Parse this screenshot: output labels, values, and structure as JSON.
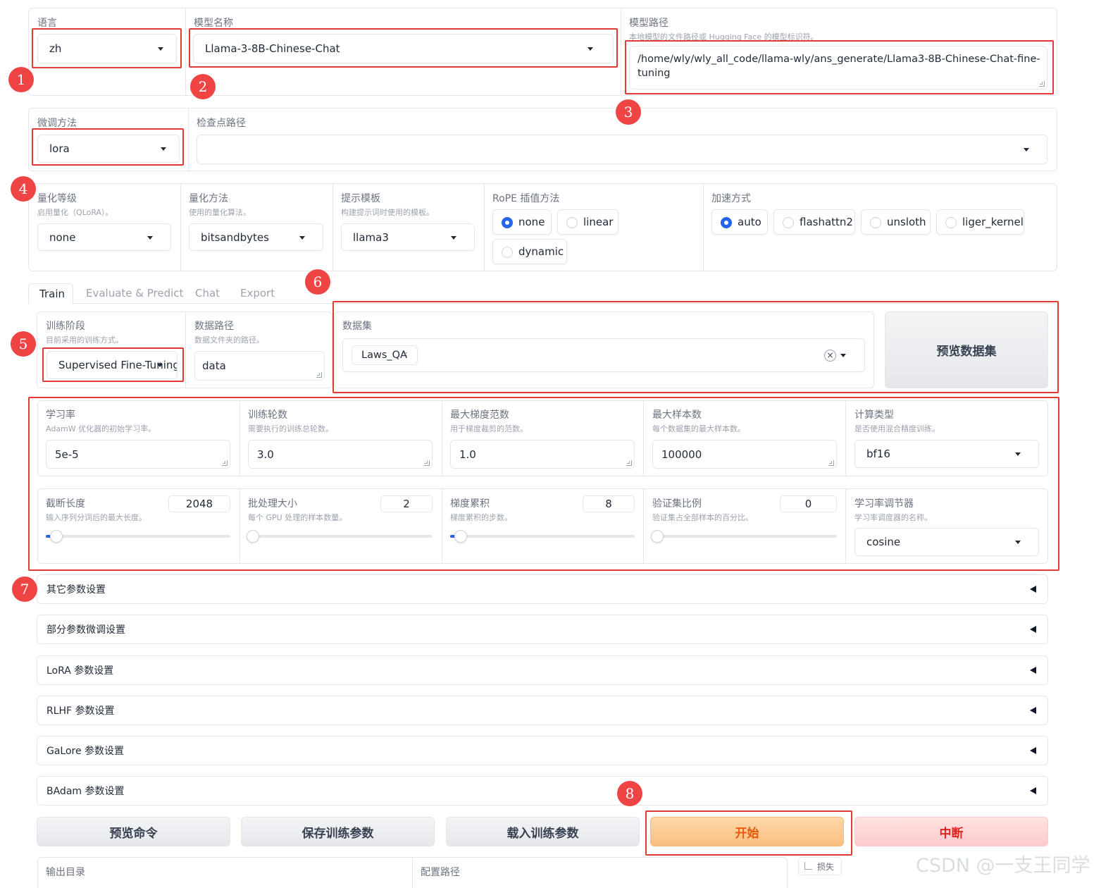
{
  "top": {
    "language": {
      "label": "语言",
      "value": "zh"
    },
    "model_name": {
      "label": "模型名称",
      "value": "Llama-3-8B-Chinese-Chat"
    },
    "model_path": {
      "label": "模型路径",
      "info": "本地模型的文件路径或 Hugging Face 的模型标识符。",
      "value_line1": "/home/wly/wly_all_code/llama-wly/ans_generate/Llama3-8B-Chinese-Chat-fine-",
      "value_line2": "tuning"
    }
  },
  "row2": {
    "finetune": {
      "label": "微调方法",
      "value": "lora"
    },
    "checkpoint": {
      "label": "检查点路径",
      "value": ""
    }
  },
  "row3": {
    "quant_bit": {
      "label": "量化等级",
      "info": "启用量化（QLoRA）。",
      "value": "none"
    },
    "quant_method": {
      "label": "量化方法",
      "info": "使用的量化算法。",
      "value": "bitsandbytes"
    },
    "template": {
      "label": "提示模板",
      "info": "构建提示词时使用的模板。",
      "value": "llama3"
    },
    "rope": {
      "label": "RoPE 插值方法",
      "options": [
        "none",
        "linear",
        "dynamic"
      ],
      "selected": "none"
    },
    "booster": {
      "label": "加速方式",
      "options": [
        "auto",
        "flashattn2",
        "unsloth",
        "liger_kernel"
      ],
      "selected": "auto"
    }
  },
  "tabs": [
    "Train",
    "Evaluate & Predict",
    "Chat",
    "Export"
  ],
  "active_tab": "Train",
  "train": {
    "stage": {
      "label": "训练阶段",
      "info": "目前采用的训练方式。",
      "value": "Supervised Fine-Tuning"
    },
    "dataset_dir": {
      "label": "数据路径",
      "info": "数据文件夹的路径。",
      "value": "data"
    },
    "dataset": {
      "label": "数据集",
      "chip": "Laws_QA",
      "chip_remove": "×",
      "clear": "×"
    },
    "preview_button": "预览数据集"
  },
  "params_row1": {
    "learning_rate": {
      "label": "学习率",
      "info": "AdamW 优化器的初始学习率。",
      "value": "5e-5"
    },
    "epochs": {
      "label": "训练轮数",
      "info": "需要执行的训练总轮数。",
      "value": "3.0"
    },
    "max_grad_norm": {
      "label": "最大梯度范数",
      "info": "用于梯度裁剪的范数。",
      "value": "1.0"
    },
    "max_samples": {
      "label": "最大样本数",
      "info": "每个数据集的最大样本数。",
      "value": "100000"
    },
    "compute_type": {
      "label": "计算类型",
      "info": "是否使用混合精度训练。",
      "value": "bf16"
    }
  },
  "params_row2": {
    "cutoff_len": {
      "label": "截断长度",
      "info": "输入序列分词后的最大长度。",
      "value": "2048",
      "fraction": 0.03
    },
    "batch_size": {
      "label": "批处理大小",
      "info": "每个 GPU 处理的样本数量。",
      "value": "2",
      "fraction": 0.0
    },
    "grad_accum": {
      "label": "梯度累积",
      "info": "梯度累积的步数。",
      "value": "8",
      "fraction": 0.03
    },
    "val_size": {
      "label": "验证集比例",
      "info": "验证集占全部样本的百分比。",
      "value": "0",
      "fraction": 0.0
    },
    "lr_scheduler": {
      "label": "学习率调节器",
      "info": "学习率调度器的名称。",
      "value": "cosine"
    }
  },
  "accordions": [
    "其它参数设置",
    "部分参数微调设置",
    "LoRA 参数设置",
    "RLHF 参数设置",
    "GaLore 参数设置",
    "BAdam 参数设置"
  ],
  "buttons": [
    "预览命令",
    "保存训练参数",
    "载入训练参数",
    "开始",
    "中断"
  ],
  "bottom": {
    "output_dir_label": "输出目录",
    "config_path_label": "配置路径",
    "loss_label": "损失"
  },
  "badges": [
    "1",
    "2",
    "3",
    "4",
    "5",
    "6",
    "7",
    "8"
  ],
  "watermark": "CSDN @一支王同学",
  "colors": {
    "annotation_red": "#e53935",
    "badge_red": "#ef4444",
    "radio_blue": "#2563eb",
    "start_orange": "#fbbf7f",
    "stop_pink": "#fecaca"
  }
}
